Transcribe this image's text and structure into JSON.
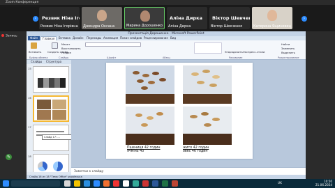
{
  "zoom": {
    "window_title": "Zoom Конференция",
    "recording_label": "Запись",
    "participants": [
      {
        "big_name": "Резвик Ніна Іго...",
        "small_name": "Резвик Ніна Ігорівна"
      },
      {
        "small_name": "Джендра Оксана"
      },
      {
        "small_name": "Марина Дорошенко"
      },
      {
        "big_name": "Аліна Дирка",
        "small_name": "Аліна Дирка"
      },
      {
        "big_name": "Віктор Шевчен...",
        "small_name": "Віктор Шевченко"
      },
      {
        "small_name": "Катерина Ящиневец"
      }
    ]
  },
  "ppt": {
    "title": "Презентація Дорошенко - Microsoft PowerPoint",
    "tabs": [
      "Файл",
      "Главная",
      "Вставка",
      "Дизайн",
      "Переходы",
      "Анимация",
      "Показ слайдов",
      "Рецензирование",
      "Вид"
    ],
    "ribbon": {
      "paste": "Вставить",
      "create_slide": "Создать слайд",
      "layout": "Макет",
      "reset": "Восстановить",
      "section": "Раздел",
      "shapes": "Фигуры",
      "arrange": "Упорядочить",
      "quick_styles": "Экспресс-стили",
      "find": "Найти",
      "replace": "Заменить",
      "select": "Выделить",
      "groups": [
        "Буфер обмена",
        "Слайды",
        "Шрифт",
        "Абзац",
        "Рисование",
        "Редактирование"
      ]
    },
    "pane_tabs": [
      "Слайды",
      "Структура"
    ],
    "thumb_numbers": [
      "15",
      "16",
      "17",
      "18"
    ],
    "tooltip": "Слайд 17: ...",
    "slide": {
      "caption_left_line1": "Пшениця 42 годин",
      "caption_left_line2": "ячмінь 40",
      "caption_right_line1": "жито 42 годин",
      "caption_right_line2": "овес 46 годин"
    },
    "notes_placeholder": "Заметки к слайду",
    "status": "Слайд 16 из 18   \"Тема Office\"   українська"
  },
  "taskbar": {
    "lang": "UK",
    "time": "10:50",
    "date": "21.06.2024"
  },
  "colors": {
    "zoom_blue": "#2d8cff",
    "ppt_accent": "#2b5797",
    "selected_thumb": "#f5b833"
  }
}
